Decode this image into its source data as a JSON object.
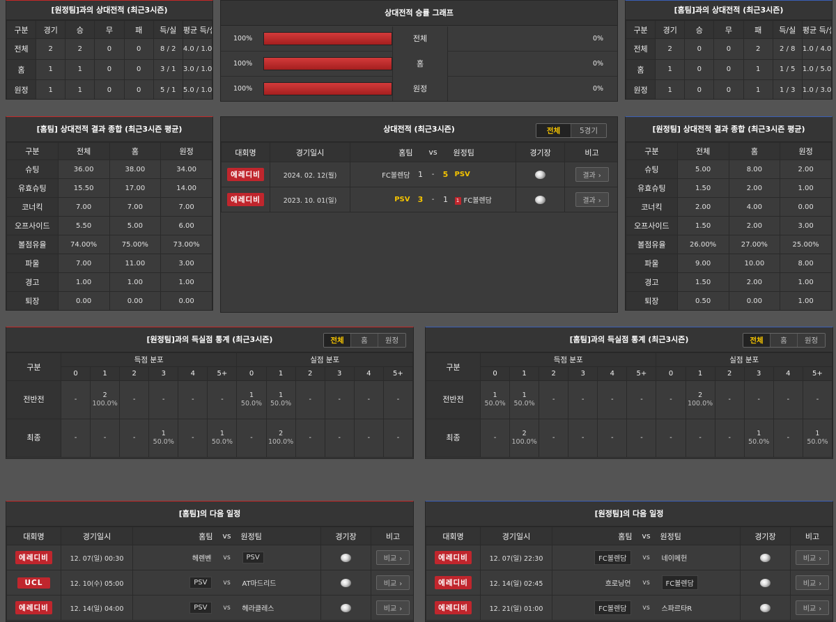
{
  "away_h2h": {
    "title": "[원정팀]과의 상대전적 (최근3시즌)",
    "headers": [
      "구분",
      "경기",
      "승",
      "무",
      "패",
      "득/실",
      "평균 득/실"
    ],
    "rows": [
      [
        "전체",
        "2",
        "2",
        "0",
        "0",
        "8 / 2",
        "4.0 / 1.0"
      ],
      [
        "홈",
        "1",
        "1",
        "0",
        "0",
        "3 / 1",
        "3.0 / 1.0"
      ],
      [
        "원정",
        "1",
        "1",
        "0",
        "0",
        "5 / 1",
        "5.0 / 1.0"
      ]
    ]
  },
  "win_graph": {
    "title": "상대전적 승률 그래프",
    "rows": [
      {
        "label": "전체",
        "left": "100%",
        "right": "0%",
        "left_ratio": 1.0,
        "right_ratio": 0.0
      },
      {
        "label": "홈",
        "left": "100%",
        "right": "0%",
        "left_ratio": 1.0,
        "right_ratio": 0.0
      },
      {
        "label": "원정",
        "left": "100%",
        "right": "0%",
        "left_ratio": 1.0,
        "right_ratio": 0.0
      }
    ]
  },
  "home_h2h": {
    "title": "[홈팀]과의 상대전적 (최근3시즌)",
    "headers": [
      "구분",
      "경기",
      "승",
      "무",
      "패",
      "득/실",
      "평균 득/실"
    ],
    "rows": [
      [
        "전체",
        "2",
        "0",
        "0",
        "2",
        "2 / 8",
        "1.0 / 4.0"
      ],
      [
        "홈",
        "1",
        "0",
        "0",
        "1",
        "1 / 5",
        "1.0 / 5.0"
      ],
      [
        "원정",
        "1",
        "0",
        "0",
        "1",
        "1 / 3",
        "1.0 / 3.0"
      ]
    ]
  },
  "home_summary": {
    "title": "[홈팀] 상대전적 결과 종합 (최근3시즌 평균)",
    "headers": [
      "구분",
      "전체",
      "홈",
      "원정"
    ],
    "rows": [
      [
        "슈팅",
        "36.00",
        "38.00",
        "34.00"
      ],
      [
        "유효슈팅",
        "15.50",
        "17.00",
        "14.00"
      ],
      [
        "코너킥",
        "7.00",
        "7.00",
        "7.00"
      ],
      [
        "오프사이드",
        "5.50",
        "5.00",
        "6.00"
      ],
      [
        "볼점유율",
        "74.00%",
        "75.00%",
        "73.00%"
      ],
      [
        "파울",
        "7.00",
        "11.00",
        "3.00"
      ],
      [
        "경고",
        "1.00",
        "1.00",
        "1.00"
      ],
      [
        "퇴장",
        "0.00",
        "0.00",
        "0.00"
      ]
    ]
  },
  "away_summary": {
    "title": "[원정팀] 상대전적 결과 종합 (최근3시즌 평균)",
    "headers": [
      "구분",
      "전체",
      "홈",
      "원정"
    ],
    "rows": [
      [
        "슈팅",
        "5.00",
        "8.00",
        "2.00"
      ],
      [
        "유효슈팅",
        "1.50",
        "2.00",
        "1.00"
      ],
      [
        "코너킥",
        "2.00",
        "4.00",
        "0.00"
      ],
      [
        "오프사이드",
        "1.50",
        "2.00",
        "3.00"
      ],
      [
        "볼점유율",
        "26.00%",
        "27.00%",
        "25.00%"
      ],
      [
        "파울",
        "9.00",
        "10.00",
        "8.00"
      ],
      [
        "경고",
        "1.50",
        "2.00",
        "1.00"
      ],
      [
        "퇴장",
        "0.50",
        "0.00",
        "1.00"
      ]
    ]
  },
  "h2h_matches": {
    "title": "상대전적 (최근3시즌)",
    "tabs": [
      "전체",
      "5경기"
    ],
    "headers": {
      "league": "대회명",
      "date": "경기일시",
      "home": "홈팀",
      "vs": "vs",
      "away": "원정팀",
      "venue": "경기장",
      "note": "비고"
    },
    "matches": [
      {
        "league": "에레디비",
        "date": "2024. 02. 12(월)",
        "home": "FC볼렌담",
        "home_score": "1",
        "dash": "-",
        "away_score": "5",
        "away": "PSV",
        "card": "",
        "result": "결과"
      },
      {
        "league": "에레디비",
        "date": "2023. 10. 01(일)",
        "home": "PSV",
        "home_score": "3",
        "dash": "-",
        "away_score": "1",
        "away": "FC볼렌담",
        "card": "1",
        "result": "결과"
      }
    ]
  },
  "goal_dist_left": {
    "title": "[원정팀]과의 득실점 통계 (최근3시즌)",
    "tabs": [
      "전체",
      "홈",
      "원정"
    ],
    "label_header": "구분",
    "score_header": "득점 분포",
    "concede_header": "실점 분포",
    "buckets": [
      "0",
      "1",
      "2",
      "3",
      "4",
      "5+"
    ],
    "rows": [
      {
        "label": "전반전",
        "cells": [
          [
            "-",
            ""
          ],
          [
            "2",
            "100.0%"
          ],
          [
            "-",
            ""
          ],
          [
            "-",
            ""
          ],
          [
            "-",
            ""
          ],
          [
            "-",
            ""
          ],
          [
            "1",
            "50.0%"
          ],
          [
            "1",
            "50.0%"
          ],
          [
            "-",
            ""
          ],
          [
            "-",
            ""
          ],
          [
            "-",
            ""
          ],
          [
            "-",
            ""
          ]
        ]
      },
      {
        "label": "최종",
        "cells": [
          [
            "-",
            ""
          ],
          [
            "-",
            ""
          ],
          [
            "-",
            ""
          ],
          [
            "1",
            "50.0%"
          ],
          [
            "-",
            ""
          ],
          [
            "1",
            "50.0%"
          ],
          [
            "-",
            ""
          ],
          [
            "2",
            "100.0%"
          ],
          [
            "-",
            ""
          ],
          [
            "-",
            ""
          ],
          [
            "-",
            ""
          ],
          [
            "-",
            ""
          ]
        ]
      }
    ]
  },
  "goal_dist_right": {
    "title": "[홈팀]과의 득실점 통계 (최근3시즌)",
    "tabs": [
      "전체",
      "홈",
      "원정"
    ],
    "label_header": "구분",
    "score_header": "득점 분포",
    "concede_header": "실점 분포",
    "buckets": [
      "0",
      "1",
      "2",
      "3",
      "4",
      "5+"
    ],
    "rows": [
      {
        "label": "전반전",
        "cells": [
          [
            "1",
            "50.0%"
          ],
          [
            "1",
            "50.0%"
          ],
          [
            "-",
            ""
          ],
          [
            "-",
            ""
          ],
          [
            "-",
            ""
          ],
          [
            "-",
            ""
          ],
          [
            "-",
            ""
          ],
          [
            "2",
            "100.0%"
          ],
          [
            "-",
            ""
          ],
          [
            "-",
            ""
          ],
          [
            "-",
            ""
          ],
          [
            "-",
            ""
          ]
        ]
      },
      {
        "label": "최종",
        "cells": [
          [
            "-",
            ""
          ],
          [
            "2",
            "100.0%"
          ],
          [
            "-",
            ""
          ],
          [
            "-",
            ""
          ],
          [
            "-",
            ""
          ],
          [
            "-",
            ""
          ],
          [
            "-",
            ""
          ],
          [
            "-",
            ""
          ],
          [
            "-",
            ""
          ],
          [
            "1",
            "50.0%"
          ],
          [
            "-",
            ""
          ],
          [
            "1",
            "50.0%"
          ]
        ]
      }
    ]
  },
  "home_next": {
    "title": "[홈팀]의 다음 일정",
    "headers": {
      "league": "대회명",
      "date": "경기일시",
      "home": "홈팀",
      "vs": "vs",
      "away": "원정팀",
      "venue": "경기장",
      "note": "비고"
    },
    "matches": [
      {
        "league": "에레디비",
        "date": "12. 07(일) 00:30",
        "home": "헤렌벤",
        "vs": "vs",
        "away": "PSV",
        "home_chip": false,
        "away_chip": true,
        "btn": "비교"
      },
      {
        "league": "UCL",
        "date": "12. 10(수) 05:00",
        "home": "PSV",
        "vs": "vs",
        "away": "AT마드리드",
        "home_chip": true,
        "away_chip": false,
        "btn": "비교"
      },
      {
        "league": "에레디비",
        "date": "12. 14(일) 04:00",
        "home": "PSV",
        "vs": "vs",
        "away": "헤라클레스",
        "home_chip": true,
        "away_chip": false,
        "btn": "비교"
      }
    ]
  },
  "away_next": {
    "title": "[원정팀]의 다음 일정",
    "headers": {
      "league": "대회명",
      "date": "경기일시",
      "home": "홈팀",
      "vs": "vs",
      "away": "원정팀",
      "venue": "경기장",
      "note": "비고"
    },
    "matches": [
      {
        "league": "에레디비",
        "date": "12. 07(일) 22:30",
        "home": "FC볼렌담",
        "vs": "vs",
        "away": "네이메헌",
        "home_chip": true,
        "away_chip": false,
        "btn": "비교"
      },
      {
        "league": "에레디비",
        "date": "12. 14(일) 02:45",
        "home": "흐로닝언",
        "vs": "vs",
        "away": "FC볼렌담",
        "home_chip": false,
        "away_chip": true,
        "btn": "비교"
      },
      {
        "league": "에레디비",
        "date": "12. 21(일) 01:00",
        "home": "FC볼렌담",
        "vs": "vs",
        "away": "스파르타R",
        "home_chip": true,
        "away_chip": false,
        "btn": "비교"
      }
    ]
  },
  "colors": {
    "accent_red": "#c0262d",
    "accent_gold": "#f5c400",
    "bar_red": "#c62828"
  },
  "icons": {
    "venue": "soccer-ball-icon",
    "more": "chevron-right-icon"
  }
}
